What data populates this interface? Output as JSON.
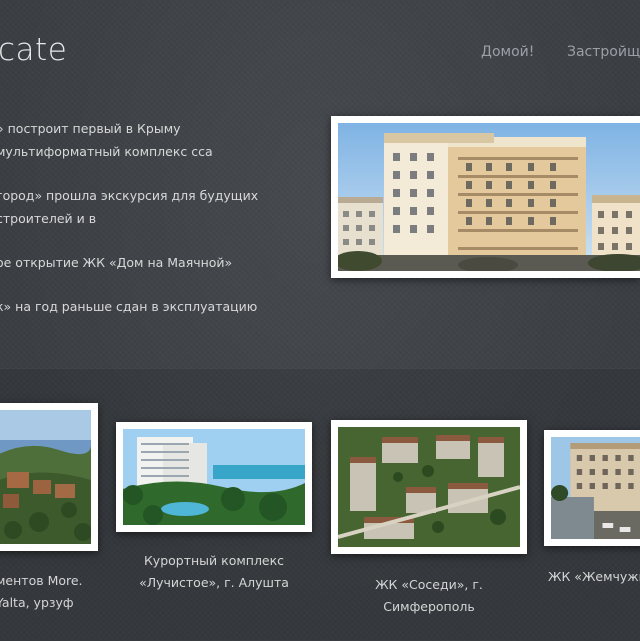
{
  "header": {
    "logo_text": "cate",
    "nav": [
      "Домой!",
      "Застройщик"
    ]
  },
  "news": [
    "» построит первый в Крыму мультиформатный комплекс сса",
    "город» прошла экскурсия для будущих строителей и в",
    "ое открытие ЖК «Дом на Маячной»",
    "к» на год раньше сдан в эксплуатацию"
  ],
  "projects": [
    {
      "caption": "ментов More. Yalta, урзуф"
    },
    {
      "caption": "Курортный комплекс «Лучистое», г. Алушта"
    },
    {
      "caption": "ЖК «Соседи», г. Симферополь"
    },
    {
      "caption": "ЖК «Жемчужина"
    }
  ]
}
